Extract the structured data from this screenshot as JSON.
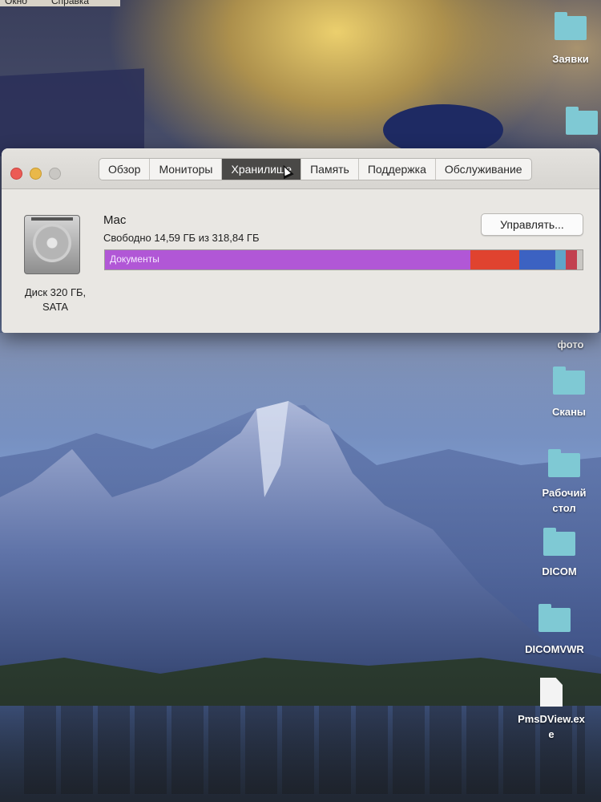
{
  "menubar": {
    "items": [
      "Окно",
      "Справка"
    ]
  },
  "window": {
    "tabs": [
      {
        "label": "Обзор",
        "active": false
      },
      {
        "label": "Мониторы",
        "active": false
      },
      {
        "label": "Хранилище",
        "active": true
      },
      {
        "label": "Память",
        "active": false
      },
      {
        "label": "Поддержка",
        "active": false
      },
      {
        "label": "Обслуживание",
        "active": false
      }
    ],
    "disk": {
      "caption_line1": "Диск 320 ГБ,",
      "caption_line2": "SATA"
    },
    "volume": {
      "name": "Mac",
      "free_text": "Свободно 14,59 ГБ из 318,84 ГБ",
      "manage_label": "Управлять..."
    },
    "storage_bar": {
      "segments": [
        {
          "name": "Документы",
          "fraction": 0.765,
          "color": "#b157d6",
          "label": "Документы"
        },
        {
          "name": "",
          "fraction": 0.102,
          "color": "#e0432f"
        },
        {
          "name": "",
          "fraction": 0.076,
          "color": "#3c62c2"
        },
        {
          "name": "",
          "fraction": 0.021,
          "color": "#5fa5c9"
        },
        {
          "name": "",
          "fraction": 0.024,
          "color": "#c2404f"
        },
        {
          "name": "",
          "fraction": 0.012,
          "color": "#c9c7c3"
        }
      ]
    }
  },
  "desktop": {
    "icons": [
      {
        "label": "Заявки",
        "type": "folder"
      },
      {
        "label": "фото",
        "type": "folder"
      },
      {
        "label": "Сканы",
        "type": "folder"
      },
      {
        "label": "Рабочий стол",
        "type": "folder"
      },
      {
        "label": "DICOM",
        "type": "folder"
      },
      {
        "label": "DICOMVWR",
        "type": "folder"
      },
      {
        "label": "PmsDView.exe",
        "type": "file"
      }
    ]
  }
}
